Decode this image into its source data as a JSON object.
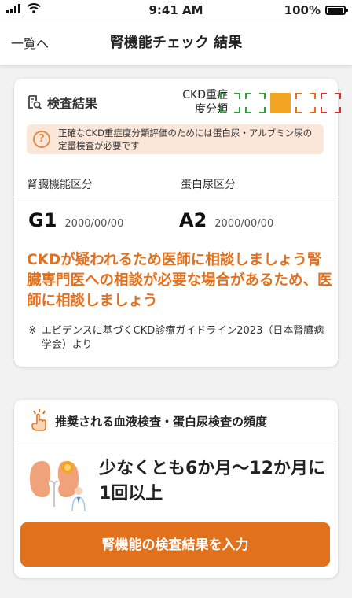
{
  "status_bar": {
    "time": "9:41 AM",
    "battery": "100%"
  },
  "nav": {
    "back_label": "一覧へ",
    "title": "腎機能チェック 結果"
  },
  "result": {
    "header": "検査結果",
    "ckd_label_line1": "CKD重症",
    "ckd_label_line2": "度分類",
    "grade_colors": [
      "#2e9e3e",
      "#2e9e3e",
      "#f3a623",
      "#e2711d",
      "#d32f2f"
    ],
    "active_grade_index": 2,
    "notice": "正確なCKD重症度分類評価のためには蛋白尿・アルブミン尿の定量検査が必要です",
    "kidney_label": "腎臓機能区分",
    "protein_label": "蛋白尿区分",
    "kidney_grade": "G1",
    "kidney_date": "2000/00/00",
    "protein_grade": "A2",
    "protein_date": "2000/00/00",
    "advice": "CKDが疑われるため医師に相談しましょう腎臓専門医への相談が必要な場合があるため、医師に相談しましょう",
    "reference_mark": "※",
    "reference": "エビデンスに基づくCKD診療ガイドライン2023（日本腎臓病学会）より"
  },
  "frequency": {
    "title": "推奨される血液検査・蛋白尿検査の頻度",
    "text": "少なくとも6か月〜12か月に1回以上",
    "button_label": "腎機能の検査結果を入力"
  },
  "colors": {
    "accent": "#e2711d",
    "notice_bg": "#fbe7da"
  }
}
